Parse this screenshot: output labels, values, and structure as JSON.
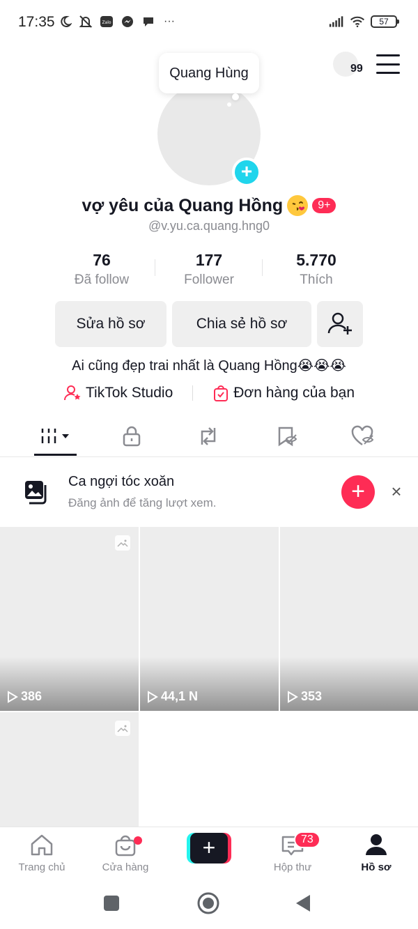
{
  "status_bar": {
    "time": "17:35",
    "battery": "57",
    "more": "···"
  },
  "header": {
    "story_count": "99"
  },
  "profile": {
    "bubble_name": "Quang Hùng",
    "display_name": "vợ yêu của Quang Hồng",
    "notif_badge": "9+",
    "username": "@v.yu.ca.quang.hng0",
    "stats": [
      {
        "value": "76",
        "label": "Đã follow"
      },
      {
        "value": "177",
        "label": "Follower"
      },
      {
        "value": "5.770",
        "label": "Thích"
      }
    ],
    "buttons": {
      "edit": "Sửa hồ sơ",
      "share": "Chia sẻ hồ sơ"
    },
    "bio": "Ai cũng đẹp trai nhất là Quang Hồng😭😭😭",
    "links": {
      "studio": "TikTok Studio",
      "orders": "Đơn hàng của bạn"
    }
  },
  "promo": {
    "title": "Ca ngợi tóc xoăn",
    "subtitle": "Đăng ảnh để tăng lượt xem."
  },
  "grid": {
    "views": [
      "386",
      "44,1 N",
      "353"
    ]
  },
  "bottom_nav": {
    "home": "Trang chủ",
    "shop": "Cửa hàng",
    "inbox": "Hộp thư",
    "inbox_badge": "73",
    "profile": "Hồ sơ"
  },
  "colors": {
    "accent": "#fe2c55",
    "cyan": "#20d5ec",
    "text": "#161823",
    "muted": "#8a8b91"
  }
}
